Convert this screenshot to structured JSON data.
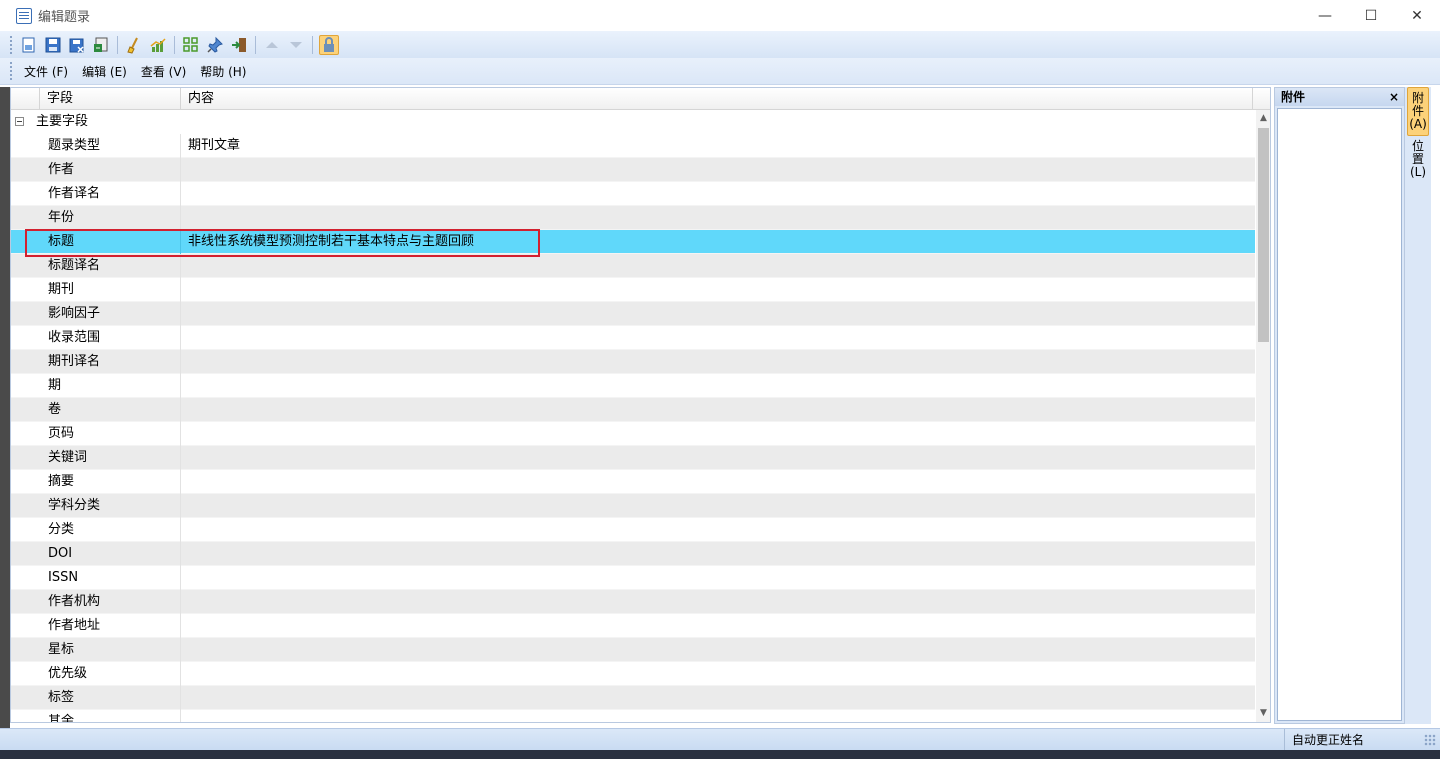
{
  "window": {
    "title": "编辑题录",
    "minimize": "—",
    "maximize": "☐",
    "close": "✕"
  },
  "toolbar": {
    "buttons": [
      "new-record-icon",
      "save-icon",
      "save-close-icon",
      "export-icon",
      "clean-icon",
      "chart-icon",
      "grid-icon",
      "pin-icon",
      "import-icon",
      "move-up-icon",
      "move-down-icon",
      "lock-icon"
    ]
  },
  "menu": {
    "file": "文件 (F)",
    "edit": "编辑 (E)",
    "view": "查看 (V)",
    "help": "帮助 (H)"
  },
  "grid": {
    "header": {
      "field": "字段",
      "content": "内容"
    },
    "group": "主要字段",
    "rows": [
      {
        "field": "题录类型",
        "value": "期刊文章"
      },
      {
        "field": "作者",
        "value": ""
      },
      {
        "field": "作者译名",
        "value": ""
      },
      {
        "field": "年份",
        "value": ""
      },
      {
        "field": "标题",
        "value": "非线性系统模型预测控制若干基本特点与主题回顾"
      },
      {
        "field": "标题译名",
        "value": ""
      },
      {
        "field": "期刊",
        "value": ""
      },
      {
        "field": "影响因子",
        "value": ""
      },
      {
        "field": "收录范围",
        "value": ""
      },
      {
        "field": "期刊译名",
        "value": ""
      },
      {
        "field": "期",
        "value": ""
      },
      {
        "field": "卷",
        "value": ""
      },
      {
        "field": "页码",
        "value": ""
      },
      {
        "field": "关键词",
        "value": ""
      },
      {
        "field": "摘要",
        "value": ""
      },
      {
        "field": "学科分类",
        "value": ""
      },
      {
        "field": "分类",
        "value": ""
      },
      {
        "field": "DOI",
        "value": ""
      },
      {
        "field": "ISSN",
        "value": ""
      },
      {
        "field": "作者机构",
        "value": ""
      },
      {
        "field": "作者地址",
        "value": ""
      },
      {
        "field": "星标",
        "value": ""
      },
      {
        "field": "优先级",
        "value": ""
      },
      {
        "field": "标签",
        "value": ""
      },
      {
        "field": "其余",
        "value": ""
      }
    ],
    "selected_row": "标题"
  },
  "panel": {
    "title": "附件",
    "close": "×"
  },
  "side_tabs": {
    "attachments": "附件(A)",
    "location": "位置(L)"
  },
  "status": {
    "text": "自动更正姓名"
  },
  "colors": {
    "selected_row": "#60d8fa",
    "highlight_box": "#d2202f",
    "toolbar_active": "#fcd27a"
  }
}
